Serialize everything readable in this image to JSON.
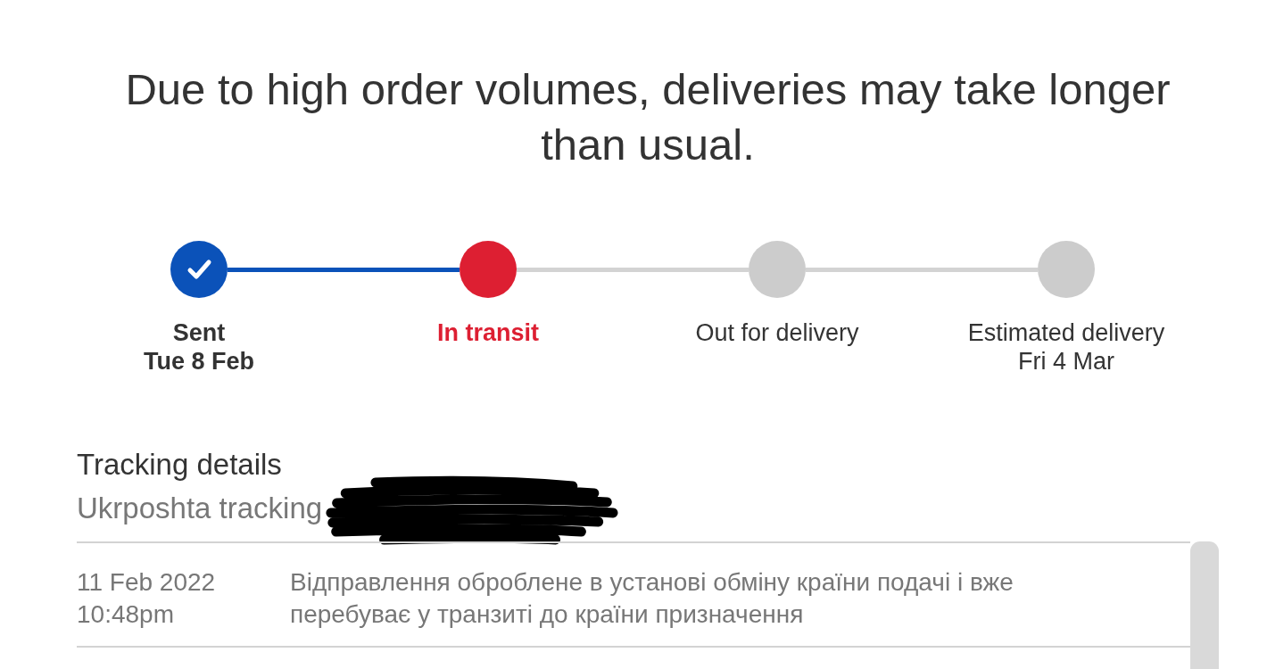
{
  "notice": {
    "text": "Due to high order volumes, deliveries may take longer than usual."
  },
  "progress": {
    "steps": [
      {
        "label": "Sent",
        "date": "Tue 8 Feb",
        "completed": true,
        "current": false
      },
      {
        "label": "In transit",
        "completed": false,
        "current": true
      },
      {
        "label": "Out for delivery",
        "completed": false,
        "current": false
      },
      {
        "label": "Estimated delivery",
        "date": "Fri 4 Mar",
        "completed": false,
        "current": false
      }
    ]
  },
  "tracking": {
    "title": "Tracking details",
    "carrier_label": "Ukrposhta tracking",
    "events": [
      {
        "date": "11 Feb 2022",
        "time": "10:48pm",
        "message": "Відправлення оброблене в установі обміну країни подачі і вже перебуває у транзиті до країни призначення"
      }
    ]
  }
}
